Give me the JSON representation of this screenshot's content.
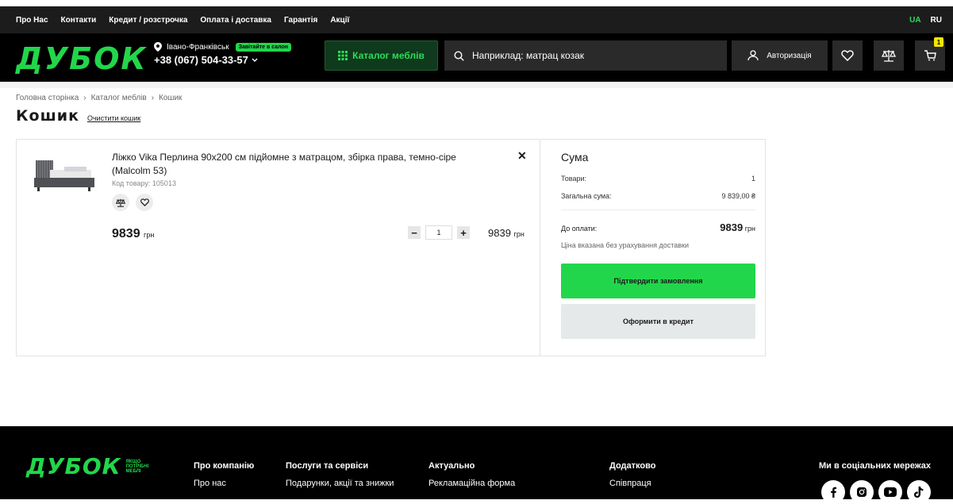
{
  "topbar": {
    "links": [
      "Про Нас",
      "Контакти",
      "Кредит / розстрочка",
      "Оплата і доставка",
      "Гарантія",
      "Акції"
    ],
    "lang_active": "UA",
    "lang_other": "RU"
  },
  "header": {
    "logo": "ДУБОК",
    "city": "Івано-Франківськ",
    "salon_badge": "Завітайте в салон",
    "phone": "+38 (067) 504-33-57",
    "catalog_label": "Каталог меблів",
    "search_placeholder": "Наприклад: матрац козак",
    "auth_label": "Авторизація",
    "cart_count": "1"
  },
  "breadcrumb": [
    "Головна сторінка",
    "Каталог меблів",
    "Кошик"
  ],
  "page": {
    "title": "Кошик",
    "clear_label": "Очистити кошик"
  },
  "item": {
    "name": "Ліжко Vika Перлина 90х200 см підйомне з матрацом, збірка права, темно-сіре (Malcolm 53)",
    "code": "Код товару: 105013",
    "price": "9839",
    "currency": "грн",
    "quantity": "1",
    "line_total": "9839"
  },
  "summary": {
    "title": "Сума",
    "goods_label": "Товари:",
    "goods_value": "1",
    "total_label": "Загальна сума:",
    "total_value": "9 839,00 ₴",
    "pay_label": "До оплати:",
    "pay_value": "9839",
    "pay_currency": "грн",
    "note": "Ціна вказана без урахування доставки",
    "confirm_label": "Підтвердити замовлення",
    "credit_label": "Оформити в кредит"
  },
  "footer": {
    "logo": "ДУБОК",
    "tagline_1": "ЯКЩО",
    "tagline_2": "ПОТРІБНІ",
    "tagline_3": "МЕБЛІ",
    "col1_title": "Про компанію",
    "col1_item": "Про нас",
    "col2_title": "Послуги та сервіси",
    "col2_item": "Подарунки, акції та знижки",
    "col3_title": "Актуально",
    "col3_item": "Рекламаційна форма",
    "col4_title": "Додатково",
    "col4_item": "Співпраця",
    "social_title": "Ми в соціальних мережах"
  },
  "colors": {
    "accent": "#22d64b",
    "dark": "#000000",
    "badge": "#f5e600"
  }
}
